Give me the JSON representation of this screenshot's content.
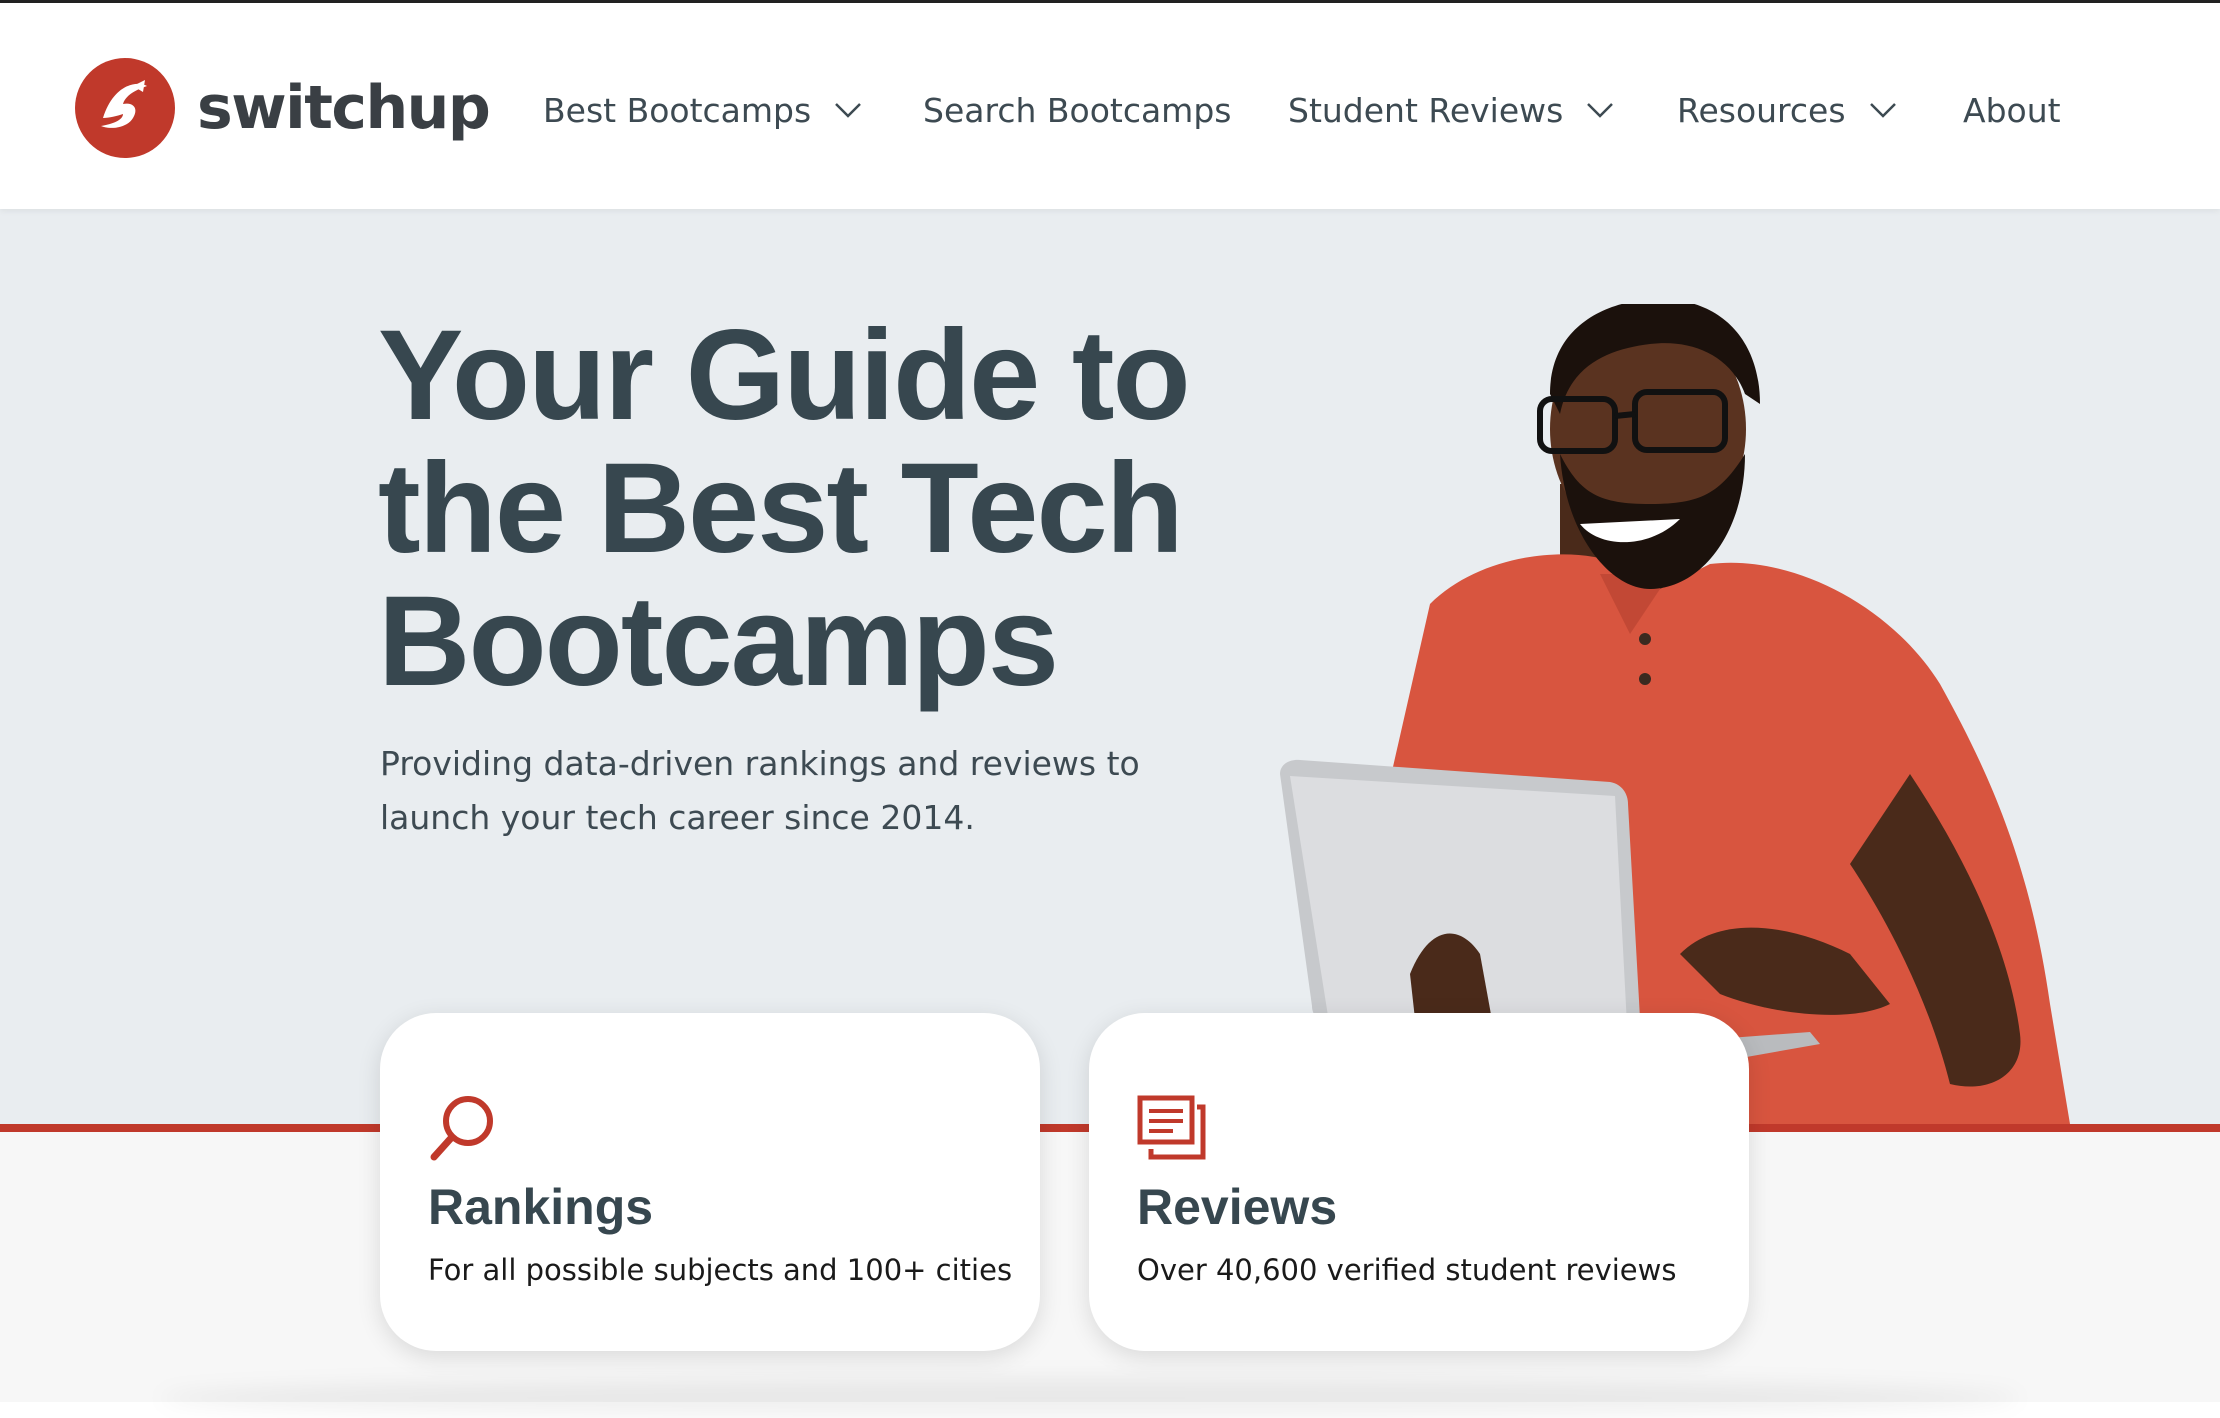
{
  "brand": {
    "name": "switchup",
    "accent_color": "#c0392b",
    "text_color": "#37474f"
  },
  "nav": {
    "items": [
      {
        "label": "Best Bootcamps",
        "has_dropdown": true
      },
      {
        "label": "Search Bootcamps",
        "has_dropdown": false
      },
      {
        "label": "Student Reviews",
        "has_dropdown": true
      },
      {
        "label": "Resources",
        "has_dropdown": true
      },
      {
        "label": "About",
        "has_dropdown": false
      }
    ]
  },
  "hero": {
    "title_lines": [
      "Your Guide to",
      "the Best Tech",
      "Bootcamps"
    ],
    "subtitle_lines": [
      "Providing data-driven rankings and reviews to",
      "launch your tech career since 2014."
    ],
    "image": "smiling-man-with-laptop"
  },
  "cards": [
    {
      "icon": "search-icon",
      "title": "Rankings",
      "description": "For all possible subjects and 100+ cities"
    },
    {
      "icon": "reviews-icon",
      "title": "Reviews",
      "description": "Over 40,600 verified student reviews"
    }
  ]
}
